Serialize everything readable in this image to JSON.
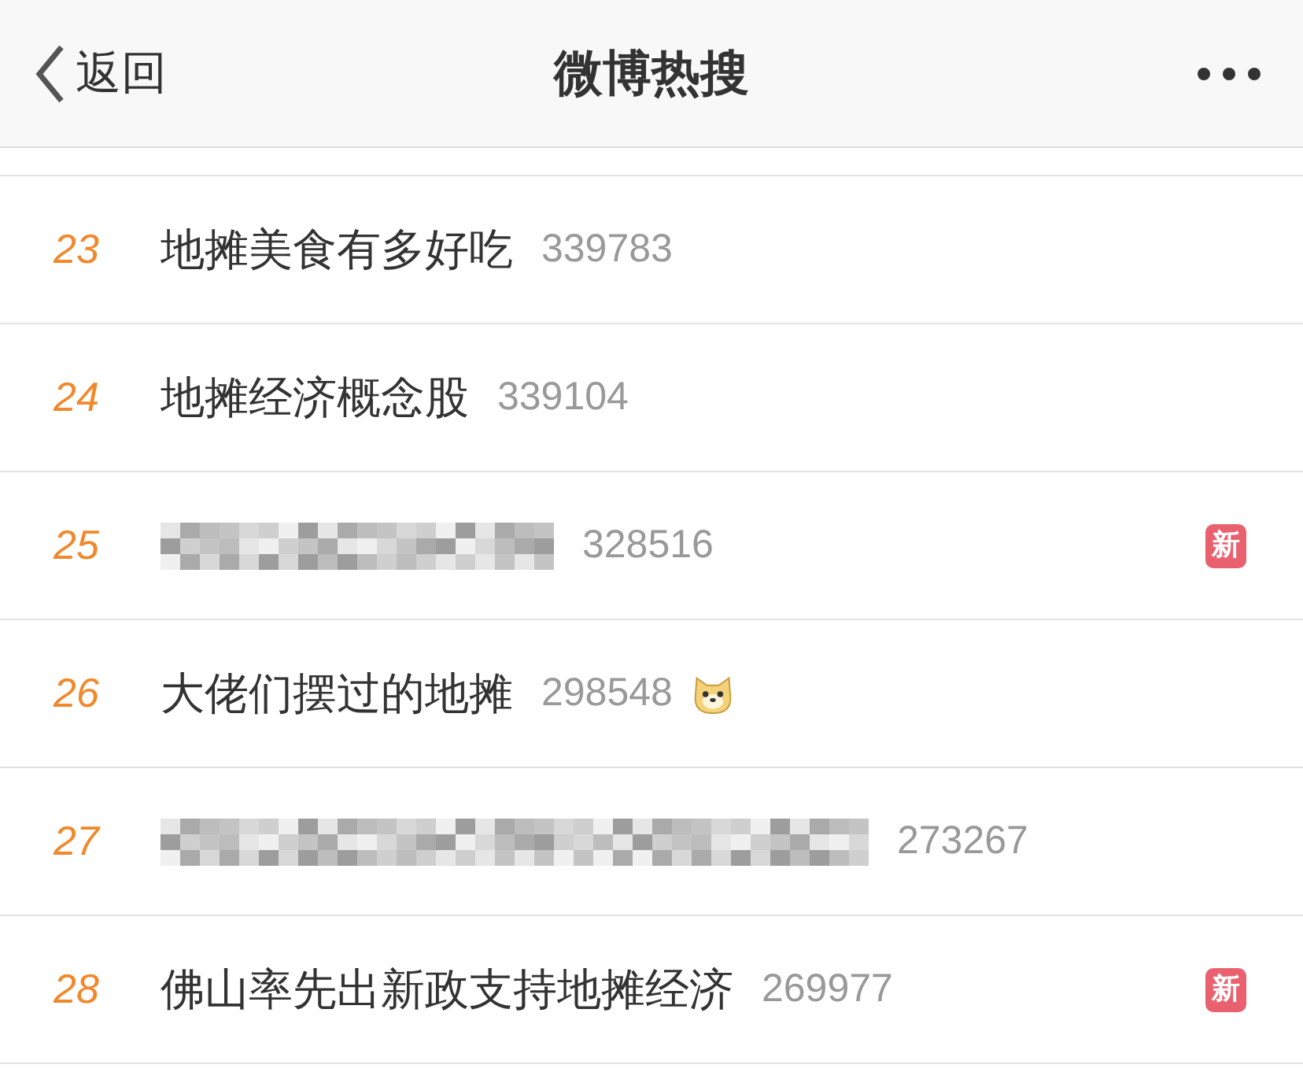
{
  "nav_bar": {
    "back_label": "返回",
    "title": "微博热搜"
  },
  "rows": [
    {
      "rank": "23",
      "kind": "text",
      "title": "地摊美食有多好吃",
      "count": "339783",
      "emoji": false
    },
    {
      "rank": "24",
      "kind": "text",
      "title": "地摊经济概念股",
      "count": "339104",
      "emoji": false
    },
    {
      "rank": "25",
      "kind": "blurshort",
      "count": "328516",
      "badge": "新",
      "emoji": false
    },
    {
      "rank": "26",
      "kind": "text",
      "title": "大佬们摆过的地摊",
      "count": "298548",
      "emoji": true
    },
    {
      "rank": "27",
      "kind": "blurlong",
      "count": "273267",
      "emoji": false
    },
    {
      "rank": "28",
      "kind": "text",
      "title": "佛山率先出新政支持地摊经济",
      "count": "269977",
      "badge": "新",
      "emoji": false
    }
  ]
}
